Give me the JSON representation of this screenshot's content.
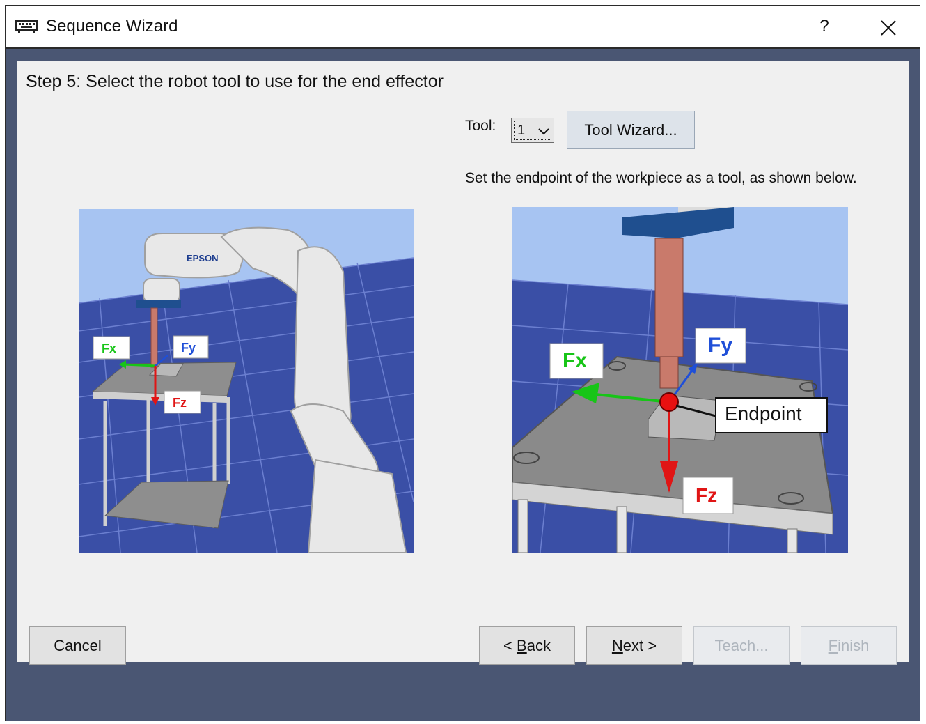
{
  "window": {
    "title": "Sequence Wizard",
    "help_label": "?",
    "app_icon": "keyboard-icon",
    "close_icon": "close-icon"
  },
  "step": {
    "title": "Step 5: Select the robot tool to use for the end effector"
  },
  "tool": {
    "label": "Tool:",
    "selected": "1",
    "wizard_button": "Tool Wizard..."
  },
  "instruction": "Set the endpoint of the workpiece as a tool, as shown below.",
  "illustration_left": {
    "brand": "EPSON",
    "fx": "Fx",
    "fy": "Fy",
    "fz": "Fz"
  },
  "illustration_right": {
    "fx": "Fx",
    "fy": "Fy",
    "fz": "Fz",
    "endpoint": "Endpoint"
  },
  "buttons": {
    "cancel": "Cancel",
    "back_prefix": "< ",
    "back_key": "B",
    "back_rest": "ack",
    "next_key": "N",
    "next_rest": "ext >",
    "teach": "Teach...",
    "finish_key": "F",
    "finish_rest": "inish"
  },
  "colors": {
    "frame": "#4a5673",
    "panel": "#f0f0f0",
    "fx": "#17c517",
    "fy": "#1f4fd8",
    "fz": "#e01515",
    "floor": "#3a4fa6",
    "sky": "#a7c4f2"
  }
}
